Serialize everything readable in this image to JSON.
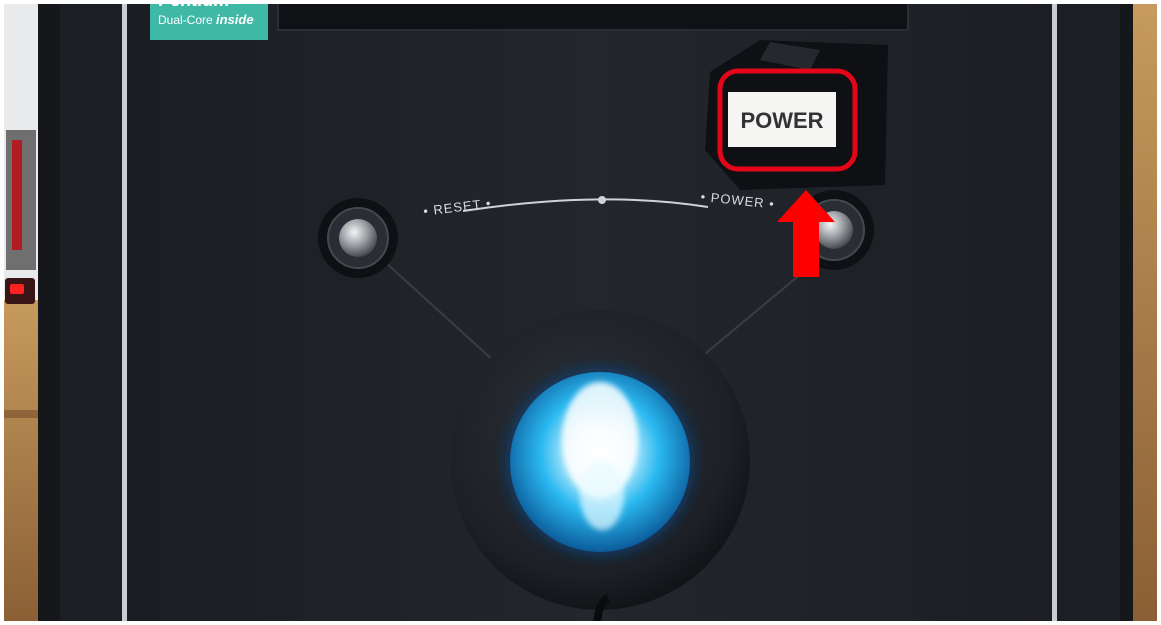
{
  "badge": {
    "line1": "Pentium",
    "line2": "Dual-Core",
    "line3": "inside"
  },
  "front_panel": {
    "arc_label_left": "• RESET •",
    "arc_label_right": "• POWER •"
  },
  "sticker": {
    "label": "POWER"
  },
  "annotation": {
    "highlight_color": "#e3061a",
    "arrow_color": "#ff0000"
  },
  "led": {
    "color": "#2ab8f0",
    "state": "on"
  }
}
